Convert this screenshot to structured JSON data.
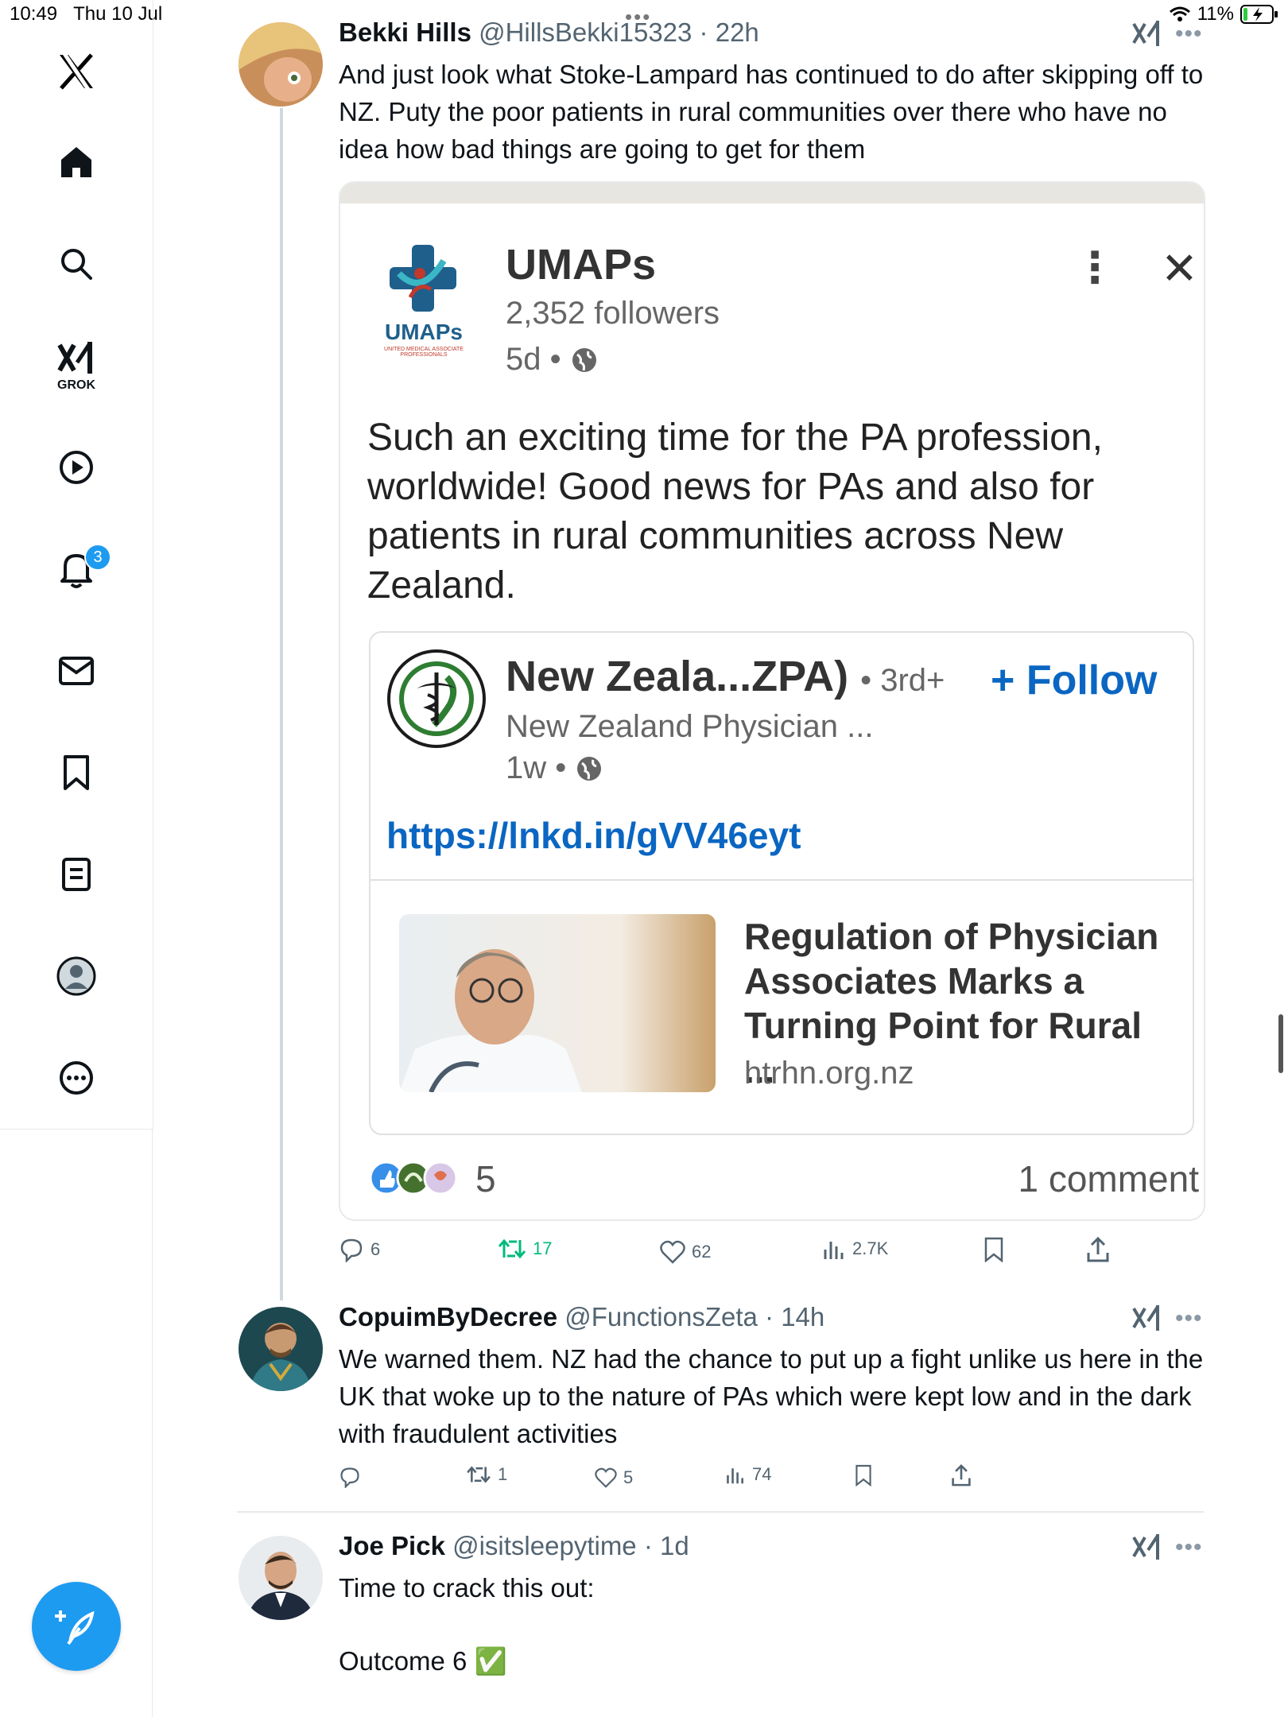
{
  "status": {
    "time": "10:49",
    "date": "Thu 10 Jul",
    "battery": "11%"
  },
  "sidebar": {
    "grok_label": "GROK",
    "notifications_badge": "3"
  },
  "tweets": [
    {
      "name": "Bekki Hills",
      "handle": "@HillsBekki15323",
      "time": "22h",
      "text": "And just look what Stoke-Lampard has continued to do after skipping off to NZ. Puty the poor patients in rural communities over there who have no idea how bad things are going to get for them",
      "replies": "6",
      "reposts": "17",
      "likes": "62",
      "views": "2.7K"
    },
    {
      "name": "CopuimByDecree",
      "handle": "@FunctionsZeta",
      "time": "14h",
      "text": "We warned them. NZ had the chance to put up a fight unlike us here in the UK that woke up to the nature of PAs which were kept low and in the dark with fraudulent activities",
      "replies": "",
      "reposts": "1",
      "likes": "5",
      "views": "74"
    },
    {
      "name": "Joe Pick",
      "handle": "@isitsleepytime",
      "time": "1d",
      "line1": "Time to crack this out:",
      "line2": "Outcome 6 ✅"
    }
  ],
  "embed": {
    "org_name": "UMAPs",
    "followers": "2,352 followers",
    "time": "5d •",
    "logo_text": "UMAPs",
    "logo_sub": "UNITED MEDICAL ASSOCIATE PROFESSIONALS",
    "text": "Such an exciting time for the PA profession, worldwide! Good news for PAs and also for patients in rural communities across New Zealand.",
    "inner": {
      "name": "New Zeala...ZPA)",
      "degree": "• 3rd+",
      "follow": "+ Follow",
      "subtitle": "New Zealand Physician ...",
      "time": "1w •",
      "link": "https://lnkd.in/gVV46eyt",
      "headline": "Regulation of Physician Associates Marks a Turning Point for Rural ...",
      "domain": "htrhn.org.nz"
    },
    "reactions": "5",
    "comments": "1 comment"
  },
  "colors": {
    "accent": "#1d9bf0",
    "linkedin_blue": "#0a66c2",
    "repost_green": "#00ba7c"
  }
}
